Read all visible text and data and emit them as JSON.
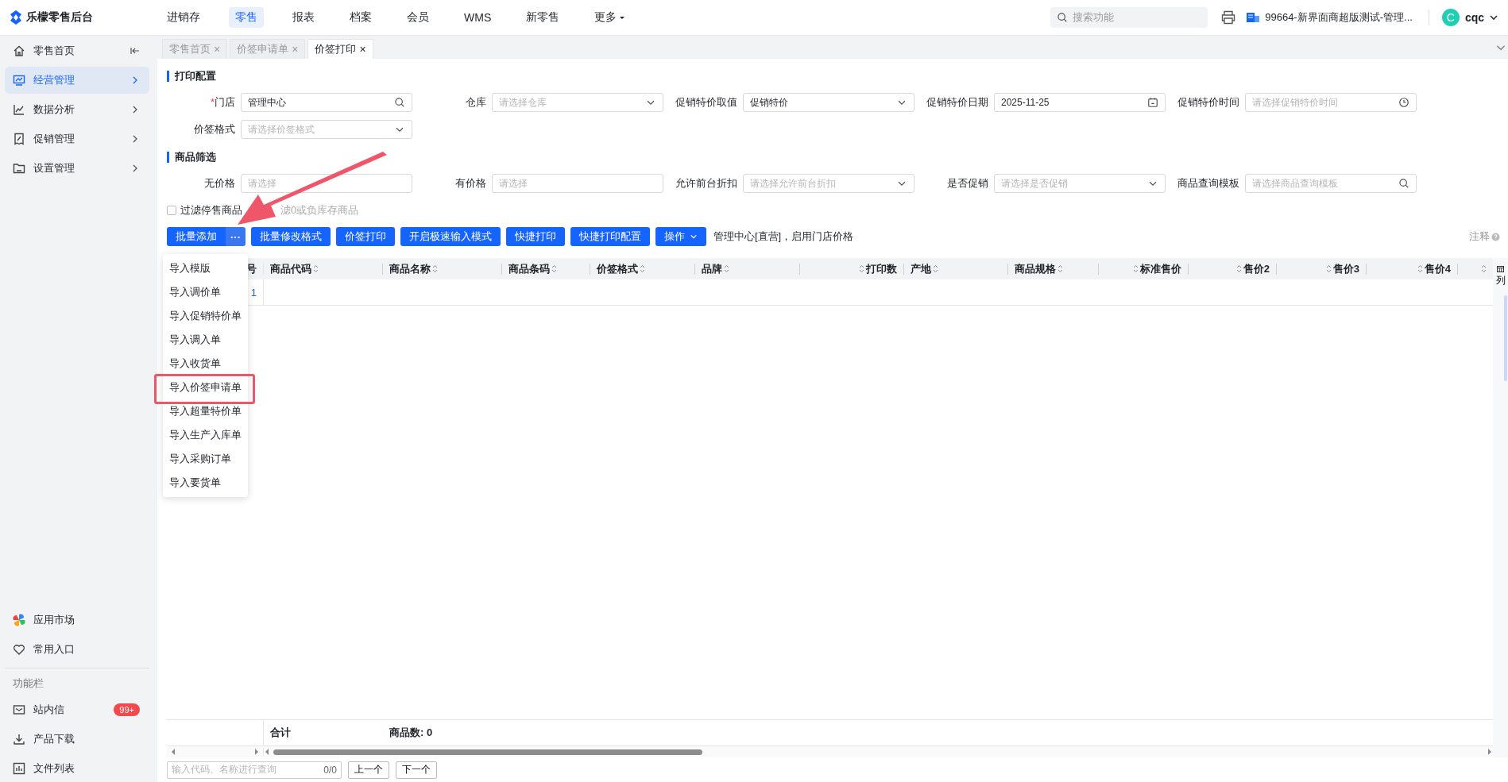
{
  "app": {
    "title": "乐檬零售后台"
  },
  "nav": [
    {
      "label": "进销存",
      "selected": false
    },
    {
      "label": "零售",
      "selected": true
    },
    {
      "label": "报表",
      "selected": false
    },
    {
      "label": "档案",
      "selected": false
    },
    {
      "label": "会员",
      "selected": false
    },
    {
      "label": "WMS",
      "selected": false
    },
    {
      "label": "新零售",
      "selected": false
    },
    {
      "label": "更多",
      "selected": false,
      "dropdown": true
    }
  ],
  "header": {
    "search_placeholder": "搜索功能",
    "store": "99664-新界面商超版测试-管理...",
    "avatar_letter": "C",
    "user": "cqc"
  },
  "sidebar": {
    "items": [
      {
        "label": "零售首页",
        "selected": false
      },
      {
        "label": "经营管理",
        "selected": true
      },
      {
        "label": "数据分析",
        "selected": false
      },
      {
        "label": "促销管理",
        "selected": false
      },
      {
        "label": "设置管理",
        "selected": false
      }
    ],
    "bottom": [
      {
        "label": "应用市场"
      },
      {
        "label": "常用入口"
      }
    ],
    "section_title": "功能栏",
    "tools": [
      {
        "label": "站内信",
        "badge": "99+"
      },
      {
        "label": "产品下载"
      },
      {
        "label": "文件列表"
      }
    ]
  },
  "tabs": [
    {
      "label": "零售首页",
      "close": "×",
      "selected": false
    },
    {
      "label": "价签申请单",
      "close": "×",
      "selected": false
    },
    {
      "label": "价签打印",
      "close": "×",
      "selected": true
    }
  ],
  "sections": [
    {
      "title": "打印配置",
      "fields": [
        {
          "label": "门店",
          "required_mark": "*",
          "value": "管理中心",
          "kind": "search"
        },
        {
          "label": "仓库",
          "placeholder": "请选择仓库",
          "kind": "select"
        },
        {
          "label": "促销特价取值",
          "value": "促销特价",
          "kind": "select"
        },
        {
          "label": "促销特价日期",
          "value": "2025-11-25",
          "kind": "date"
        },
        {
          "label": "促销特价时间",
          "placeholder": "请选择促销特价时间",
          "kind": "time"
        },
        {
          "label": "价签格式",
          "placeholder": "请选择价签格式",
          "kind": "select"
        }
      ]
    },
    {
      "title": "商品筛选",
      "fields": [
        {
          "label": "无价格",
          "placeholder": "请选择",
          "kind": "text"
        },
        {
          "label": "有价格",
          "placeholder": "请选择",
          "kind": "text"
        },
        {
          "label": "允许前台折扣",
          "placeholder": "请选择允许前台折扣",
          "kind": "select"
        },
        {
          "label": "是否促销",
          "placeholder": "请选择是否促销",
          "kind": "select"
        },
        {
          "label": "商品查询模板",
          "placeholder": "请选择商品查询模板",
          "kind": "search"
        }
      ]
    }
  ],
  "filters": [
    {
      "label": "过滤停售商品",
      "checked": false
    },
    {
      "label": "滤0或负库存商品",
      "disabled": true
    }
  ],
  "toolbar": {
    "buttons": [
      {
        "label": "批量添加",
        "kind": "split",
        "more": "···"
      },
      {
        "label": "批量修改格式",
        "kind": "plain"
      },
      {
        "label": "价签打印",
        "kind": "plain"
      },
      {
        "label": "开启极速输入模式",
        "kind": "plain"
      },
      {
        "label": "快捷打印",
        "kind": "plain"
      },
      {
        "label": "快捷打印配置",
        "kind": "plain"
      },
      {
        "label": "操作",
        "kind": "dropdown"
      }
    ],
    "info": "管理中心[直营]，启用门店价格",
    "note": "注释"
  },
  "menu": [
    {
      "label": "导入模版",
      "annotated": false
    },
    {
      "label": "导入调价单",
      "annotated": false
    },
    {
      "label": "导入促销特价单",
      "annotated": false
    },
    {
      "label": "导入调入单",
      "annotated": false
    },
    {
      "label": "导入收货单",
      "annotated": false
    },
    {
      "label": "导入价签申请单",
      "annotated": true
    },
    {
      "label": "导入超量特价单",
      "annotated": false
    },
    {
      "label": "导入生产入库单",
      "annotated": false
    },
    {
      "label": "导入采购订单",
      "annotated": false
    },
    {
      "label": "导入要货单",
      "annotated": false
    }
  ],
  "table": {
    "columns": [
      {
        "label": "号",
        "kind": "index",
        "sortable": false
      },
      {
        "label": "商品代码",
        "kind": "text",
        "sortable": true
      },
      {
        "label": "商品名称",
        "kind": "text",
        "sortable": true
      },
      {
        "label": "商品条码",
        "kind": "text",
        "sortable": true
      },
      {
        "label": "价签格式",
        "kind": "text",
        "sortable": true
      },
      {
        "label": "品牌",
        "kind": "text",
        "sortable": true
      },
      {
        "label": "打印数",
        "kind": "number",
        "sortable": true
      },
      {
        "label": "产地",
        "kind": "text",
        "sortable": true
      },
      {
        "label": "商品规格",
        "kind": "text",
        "sortable": true
      },
      {
        "label": "标准售价",
        "kind": "number",
        "sortable": true
      },
      {
        "label": "售价2",
        "kind": "number",
        "sortable": true
      },
      {
        "label": "售价3",
        "kind": "number",
        "sortable": true
      },
      {
        "label": "售价4",
        "kind": "number",
        "sortable": true
      },
      {
        "kind": "number",
        "sortable": true
      }
    ],
    "rows": [
      [
        "1"
      ]
    ],
    "column_settings": "列",
    "footer": {
      "total_label": "合计",
      "count": "商品数: 0"
    }
  },
  "finder": {
    "placeholder": "输入代码、名称进行查询",
    "count": "0/0",
    "prev": "上一个",
    "next": "下一个"
  }
}
